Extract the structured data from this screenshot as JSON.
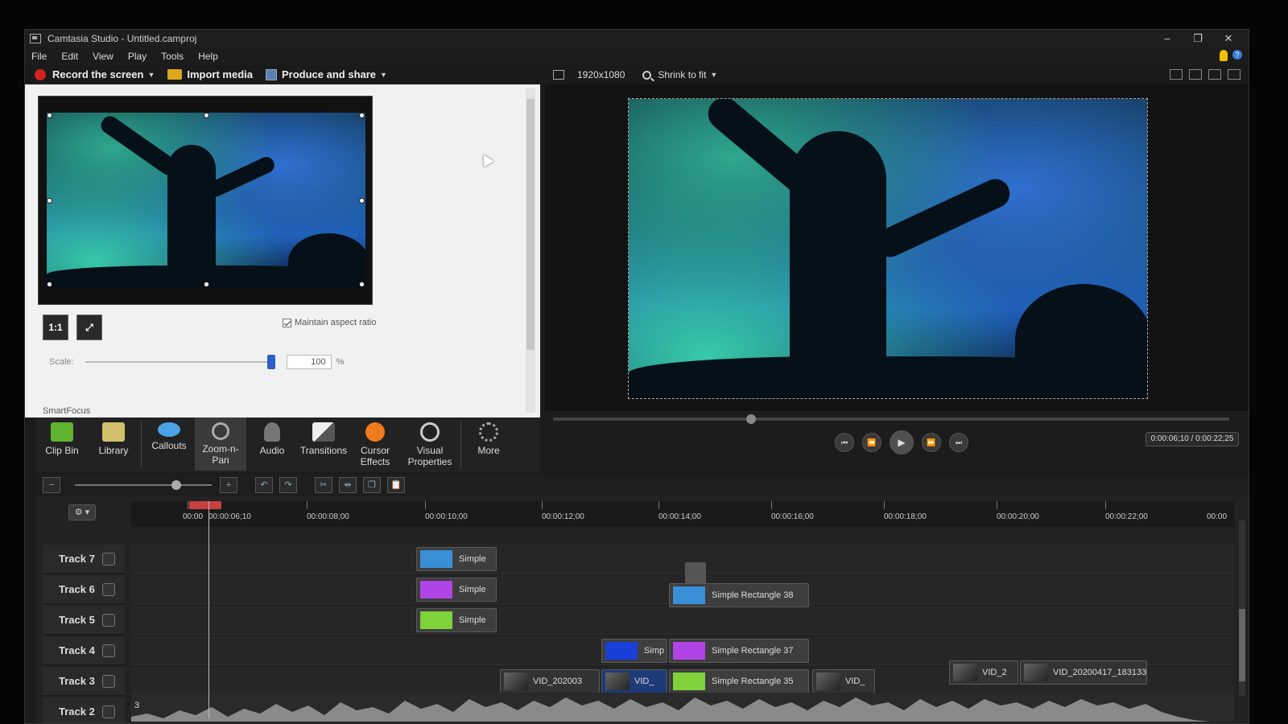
{
  "window": {
    "title": "Camtasia Studio - Untitled.camproj",
    "controls": [
      "–",
      "❐",
      "✕"
    ]
  },
  "menu": [
    "File",
    "Edit",
    "View",
    "Play",
    "Tools",
    "Help"
  ],
  "toolbar": {
    "record": "Record the screen",
    "import": "Import media",
    "produce": "Produce and share"
  },
  "editor": {
    "view_1to1": "1:1",
    "maintain_aspect": "Maintain aspect ratio",
    "scale_label": "Scale:",
    "scale_value": "100",
    "scale_unit": "%",
    "section": "SmartFocus"
  },
  "tasks": [
    {
      "label": "Clip Bin",
      "icon": "film-icon",
      "color": "#5fb32e"
    },
    {
      "label": "Library",
      "icon": "library-icon",
      "color": "#d2c06a"
    },
    {
      "label": "Callouts",
      "icon": "speech-bubble-icon",
      "color": "#4aa3e6"
    },
    {
      "label": "Zoom-n-Pan",
      "icon": "magnifier-icon",
      "color": "#999999"
    },
    {
      "label": "Audio",
      "icon": "speaker-icon",
      "color": "#bbbbbb"
    },
    {
      "label": "Transitions",
      "icon": "transitions-icon",
      "color": "#dddddd"
    },
    {
      "label": "Cursor Effects",
      "icon": "cursor-effects-icon",
      "color": "#f07a1e"
    },
    {
      "label": "Visual Properties",
      "icon": "visual-properties-icon",
      "color": "#cccccc"
    },
    {
      "label": "More",
      "icon": "more-icon",
      "color": "#aaaaaa"
    }
  ],
  "preview": {
    "resolution": "1920x1080",
    "zoom": "Shrink to fit",
    "timecode": "0:00:06;10 / 0:00:22;25"
  },
  "timeline": {
    "ruler": [
      "00:00",
      "00:00:06;10",
      "00:00:08;00",
      "00:00:10;00",
      "00:00:12;00",
      "00:00:14;00",
      "00:00:16;00",
      "00:00:18;00",
      "00:00:20;00",
      "00:00:22;00",
      "00:00"
    ],
    "tracks": [
      "Track 7",
      "Track 6",
      "Track 5",
      "Track 4",
      "Track 3",
      "Track 2"
    ],
    "clips": {
      "t7": "Simple",
      "t6": "Simple",
      "t5a": "Simple",
      "t5b": "Simple Rectangle 38",
      "t4a": "Simp",
      "t4b": "Simple Rectangle 37",
      "t3a": "VID_202003",
      "t3b": "VID_",
      "t3c": "Simple Rectangle 35",
      "t3d": "VID_",
      "t3e": "VID_2",
      "t3f": "VID_20200417_183133",
      "t2": "3"
    }
  },
  "colors": {
    "blue_rect": "#3a8fd6",
    "purple_rect": "#b044e6",
    "green_rect": "#7fd23a",
    "navy_rect": "#1a3fd8"
  }
}
